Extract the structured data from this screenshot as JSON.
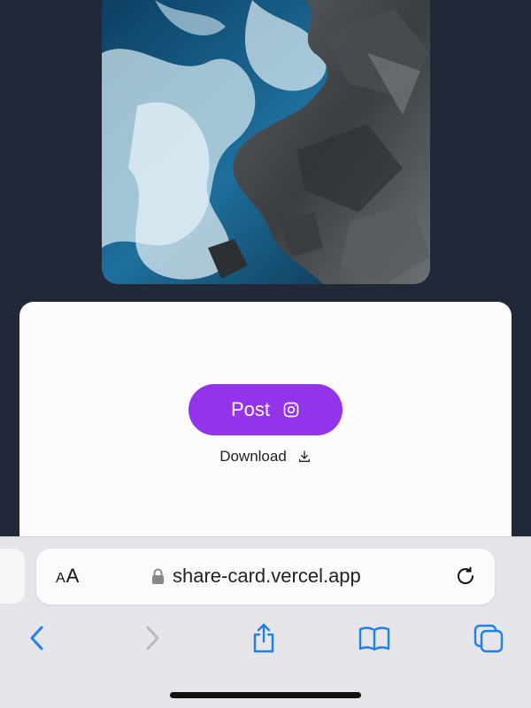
{
  "card": {
    "post_label": "Post",
    "download_label": "Download"
  },
  "browser": {
    "text_size_label_small": "A",
    "text_size_label_large": "A",
    "url": "share-card.vercel.app"
  },
  "colors": {
    "page_background": "#212838",
    "card_background": "#fdfbfc",
    "post_button": "#9333ea",
    "toolbar_accent": "#1e7ff0",
    "toolbar_disabled": "#b9b9be"
  },
  "icons": {
    "post": "instagram-icon",
    "download": "download-icon",
    "lock": "lock-icon",
    "reload": "reload-icon",
    "back": "chevron-left-icon",
    "forward": "chevron-right-icon",
    "share": "share-icon",
    "bookmarks": "book-icon",
    "tabs": "tabs-icon"
  }
}
